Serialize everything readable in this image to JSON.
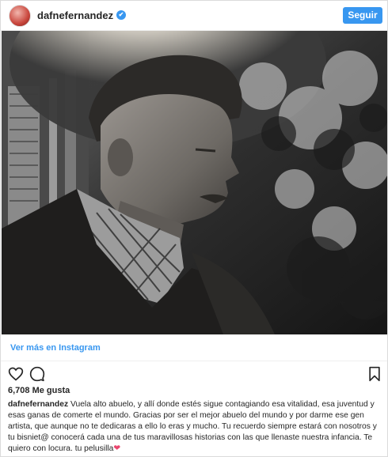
{
  "header": {
    "username": "dafnefernandez",
    "verified_mark": "✔",
    "follow_label": "Seguir"
  },
  "photo": {
    "description_icon": "grayscale-portrait-photo"
  },
  "view_more": {
    "label": "Ver más en Instagram"
  },
  "actions": {
    "like_icon": "heart-outline-icon",
    "comment_icon": "comment-bubble-icon",
    "save_icon": "bookmark-icon"
  },
  "likes": {
    "text": "6,708 Me gusta"
  },
  "caption": {
    "username": "dafnefernandez",
    "text": "Vuela alto abuelo, y allí donde estés sigue contagiando esa vitalidad, esa juventud y esas ganas de comerte el mundo. Gracias por ser el mejor abuelo del mundo y por darme ese gen artista, que aunque no te dedicaras a ello lo eras y mucho. Tu recuerdo siempre estará con nosotros y tu bisniet@ conocerá cada una de tus maravillosas historias con las que llenaste nuestra infancia. Te quiero con locura. tu pelusilla",
    "emoji": "❤"
  },
  "colors": {
    "accent": "#3897f0",
    "text": "#262626",
    "border": "#dbdbdb"
  }
}
